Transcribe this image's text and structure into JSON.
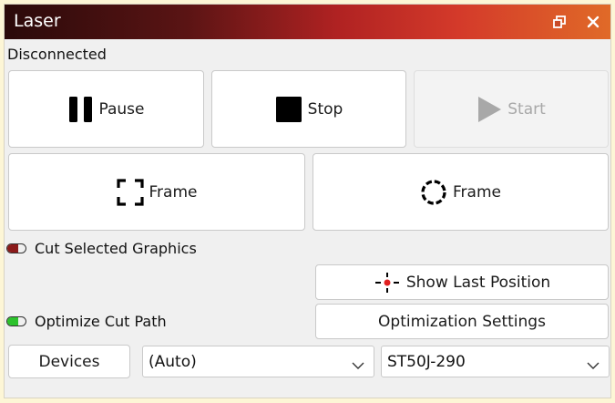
{
  "window": {
    "title": "Laser",
    "restore_icon": "restore-window-icon",
    "close_icon": "close-icon"
  },
  "status": "Disconnected",
  "controls": {
    "pause_label": "Pause",
    "stop_label": "Stop",
    "start_label": "Start",
    "frame_rect_label": "Frame",
    "frame_circle_label": "Frame"
  },
  "options": {
    "cut_selected_label": "Cut Selected Graphics",
    "cut_selected_on": false,
    "show_last_position_label": "Show Last Position",
    "optimize_label": "Optimize Cut Path",
    "optimize_on": true,
    "optimization_settings_label": "Optimization Settings"
  },
  "devices": {
    "button_label": "Devices",
    "port_value": "(Auto)",
    "device_value": "ST50J-290"
  },
  "colors": {
    "toggle_off": "#8b1a1a",
    "toggle_on": "#2cc22c",
    "crosshair": "#e02020"
  }
}
